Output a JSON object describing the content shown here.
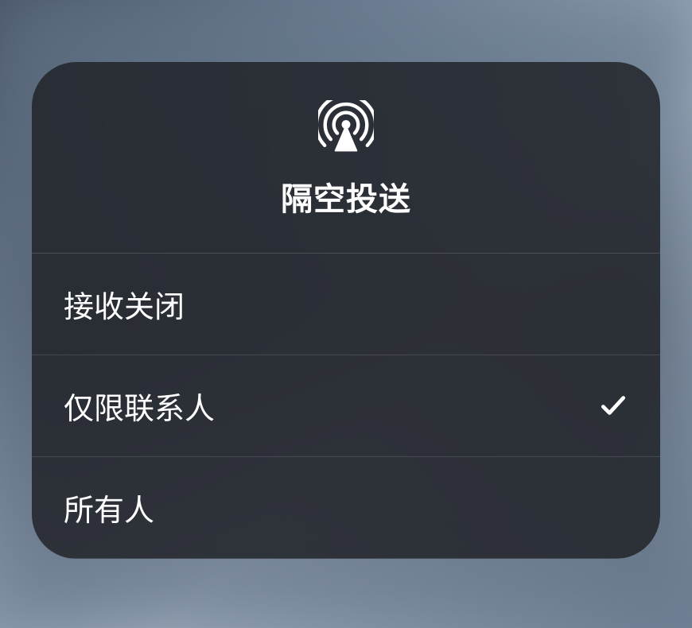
{
  "title": "隔空投送",
  "options": [
    {
      "label": "接收关闭",
      "selected": false
    },
    {
      "label": "仅限联系人",
      "selected": true
    },
    {
      "label": "所有人",
      "selected": false
    }
  ]
}
